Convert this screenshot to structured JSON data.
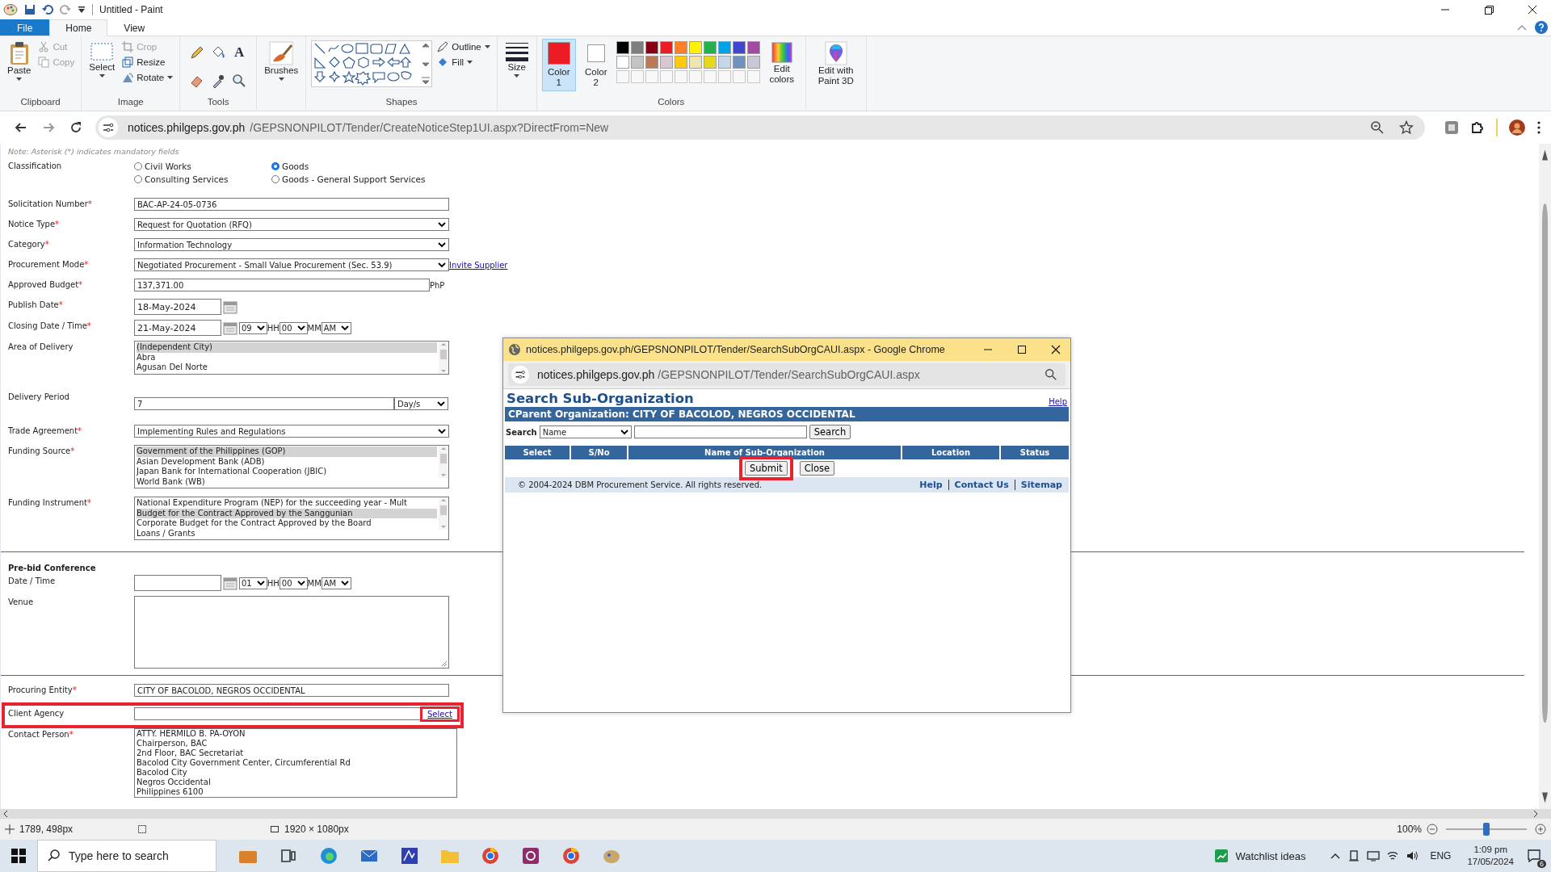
{
  "title_bar": {
    "title": "Untitled - Paint"
  },
  "ribbon_tabs": [
    {
      "label": "File",
      "kind": "file",
      "selected": false
    },
    {
      "label": "Home",
      "kind": "tab",
      "selected": true
    },
    {
      "label": "View",
      "kind": "tab",
      "selected": false
    }
  ],
  "clipboard": {
    "label": "Clipboard",
    "paste": "Paste",
    "cut": {
      "label": "Cut",
      "disabled": true
    },
    "copy": {
      "label": "Copy",
      "disabled": true
    }
  },
  "image": {
    "label": "Image",
    "select": "Select",
    "crop": {
      "label": "Crop",
      "disabled": true
    },
    "resize": {
      "label": "Resize",
      "disabled": false
    },
    "rotate": "Rotate"
  },
  "tools": {
    "label": "Tools",
    "text_tool": "A"
  },
  "brushes": "Brushes",
  "shapes": {
    "label": "Shapes",
    "outline": "Outline",
    "fill": "Fill"
  },
  "size": "Size",
  "colors": {
    "label": "Colors",
    "color1": {
      "label": "Color 1",
      "color": "#ed1c24",
      "selected": true
    },
    "color2": {
      "label": "Color 2",
      "color": "#ffffff",
      "selected": false
    },
    "palette": [
      {
        "color": "#000000"
      },
      {
        "color": "#7f7f7f"
      },
      {
        "color": "#880015"
      },
      {
        "color": "#ed1c24"
      },
      {
        "color": "#ff7f27"
      },
      {
        "color": "#fff200"
      },
      {
        "color": "#22b14c"
      },
      {
        "color": "#00a2e8"
      },
      {
        "color": "#3f48cc"
      },
      {
        "color": "#a349a4"
      },
      {
        "color": "#ffffff"
      },
      {
        "color": "#c3c3c3"
      },
      {
        "color": "#b97a57"
      },
      {
        "color": "#d8c6d0"
      },
      {
        "color": "#ffc90e"
      },
      {
        "color": "#efe4b0"
      },
      {
        "color": "#e6d81d"
      },
      {
        "color": "#c4d8ea"
      },
      {
        "color": "#7092be"
      },
      {
        "color": "#c8c8d8"
      }
    ],
    "edit": "Edit colors"
  },
  "paint3d": "Edit with Paint 3D",
  "browser": {
    "url_host": "notices.philgeps.gov.ph",
    "url_path": "/GEPSNONPILOT/Tender/CreateNoticeStep1UI.aspx?DirectFrom=New"
  },
  "form": {
    "note": "Note: Asterisk (*) indicates mandatory fields",
    "classification": {
      "label": "Classification",
      "options": [
        {
          "label": "Civil Works",
          "checked": false
        },
        {
          "label": "Goods",
          "checked": true
        },
        {
          "label": "Consulting Services",
          "checked": false
        },
        {
          "label": "Goods - General Support Services",
          "checked": false
        }
      ]
    },
    "rows": [
      {
        "kind": "text",
        "label": "Solicitation Number",
        "asterisk": "*",
        "value": "BAC-AP-24-05-0736"
      },
      {
        "kind": "select",
        "label": "Notice Type",
        "asterisk": "*",
        "value": "Request for Quotation (RFQ)"
      },
      {
        "kind": "select",
        "label": "Category",
        "asterisk": "*",
        "value": "Information Technology"
      },
      {
        "kind": "select",
        "label": "Procurement Mode",
        "asterisk": "*",
        "value": "Negotiated Procurement - Small Value Procurement (Sec. 53.9)",
        "link": "Invite Supplier"
      },
      {
        "kind": "amount",
        "label": "Approved Budget",
        "asterisk": "*",
        "value": "137,371.00",
        "suffix": "PhP"
      },
      {
        "kind": "date",
        "label": "Publish Date",
        "asterisk": "*",
        "value": "18-May-2024"
      },
      {
        "kind": "datetime",
        "label": "Closing Date / Time",
        "asterisk": "*",
        "value": "21-May-2024",
        "hour": "09",
        "hour_unit": "HH",
        "minute": "00",
        "minute_unit": "MM",
        "ampm": "AM"
      },
      {
        "kind": "listbox",
        "label": "Area of Delivery",
        "options": [
          {
            "text": "(Independent City)",
            "selected": true
          },
          {
            "text": "Abra",
            "selected": false
          },
          {
            "text": "Agusan Del Norte",
            "selected": false
          }
        ]
      },
      {
        "kind": "period",
        "label": "Delivery Period",
        "value": "7",
        "unit": "Day/s"
      },
      {
        "kind": "select",
        "label": "Trade Agreement",
        "asterisk": "*",
        "value": "Implementing Rules and Regulations"
      },
      {
        "kind": "listbox",
        "label": "Funding Source",
        "asterisk": "*",
        "options": [
          {
            "text": "Government of the Philippines (GOP)",
            "selected": true
          },
          {
            "text": "Asian Development Bank (ADB)",
            "selected": false
          },
          {
            "text": "Japan Bank for International Cooperation (JBIC)",
            "selected": false
          },
          {
            "text": "World Bank (WB)",
            "selected": false
          }
        ]
      },
      {
        "kind": "listbox",
        "label": "Funding Instrument",
        "asterisk": "*",
        "options": [
          {
            "text": "National Expenditure Program (NEP) for the succeeding year - Mult",
            "selected": false
          },
          {
            "text": "Budget for the Contract Approved by the Sanggunian",
            "selected": true
          },
          {
            "text": "Corporate Budget for the Contract Approved by the Board",
            "selected": false
          },
          {
            "text": "Loans / Grants",
            "selected": false
          }
        ]
      },
      {
        "kind": "divider"
      },
      {
        "kind": "heading",
        "label": "Pre-bid Conference"
      },
      {
        "kind": "datetime",
        "label": "Date / Time",
        "hour": "01",
        "hour_unit": "HH",
        "minute": "00",
        "minute_unit": "MM",
        "ampm": "AM"
      },
      {
        "kind": "textarea",
        "label": "Venue"
      },
      {
        "kind": "divider"
      },
      {
        "kind": "text",
        "label": "Procuring Entity",
        "asterisk": "*",
        "value": "CITY OF BACOLOD, NEGROS OCCIDENTAL"
      },
      {
        "kind": "lookup",
        "label": "Client Agency",
        "link": "Select",
        "highlighted": true
      },
      {
        "kind": "textarea",
        "label": "Contact Person",
        "asterisk": "*",
        "lines": [
          "ATTY. HERMILO B. PA-OYON",
          "Chairperson, BAC",
          "2nd Floor, BAC Secretariat",
          "Bacolod City Government Center, Circumferential Rd",
          "Bacolod City",
          "Negros Occidental",
          "Philippines 6100"
        ]
      }
    ]
  },
  "popup": {
    "title": "notices.philgeps.gov.ph/GEPSNONPILOT/Tender/SearchSubOrgCAUI.aspx - Google Chrome",
    "url_host": "notices.philgeps.gov.ph",
    "url_path": "/GEPSNONPILOT/Tender/SearchSubOrgCAUI.aspx",
    "heading": "Search Sub-Organization",
    "help": "Help",
    "parent": "CParent Organization: CITY OF BACOLOD, NEGROS OCCIDENTAL",
    "search_label": "Search",
    "search_by": "Name",
    "search_button": "Search",
    "columns": [
      "Select",
      "S/No",
      "Name of Sub-Organization",
      "Location",
      "Status"
    ],
    "buttons": [
      {
        "label": "Submit",
        "highlighted": true
      },
      {
        "label": "Close",
        "highlighted": false
      }
    ],
    "copyright": "© 2004-2024  DBM Procurement Service. All rights reserved.",
    "footer_links": [
      "Help",
      "Contact Us",
      "Sitemap"
    ]
  },
  "status_bar": {
    "cursor": "1789, 498px",
    "size": "1920 × 1080px",
    "zoom": "100%",
    "zoom_slider": {
      "level": 0.5
    }
  },
  "taskbar": {
    "search_placeholder": "Type here to search",
    "apps": [
      {
        "kind": "briefcase"
      },
      {
        "kind": "taskview"
      },
      {
        "kind": "edge"
      },
      {
        "kind": "mail"
      },
      {
        "kind": "app"
      },
      {
        "kind": "folder"
      },
      {
        "kind": "chrome"
      },
      {
        "kind": "pdf"
      },
      {
        "kind": "chrome"
      },
      {
        "kind": "paint"
      }
    ],
    "widget": "Watchlist ideas",
    "language": "ENG",
    "time": "1:09 pm",
    "date": "17/05/2024",
    "notifications": "6"
  }
}
